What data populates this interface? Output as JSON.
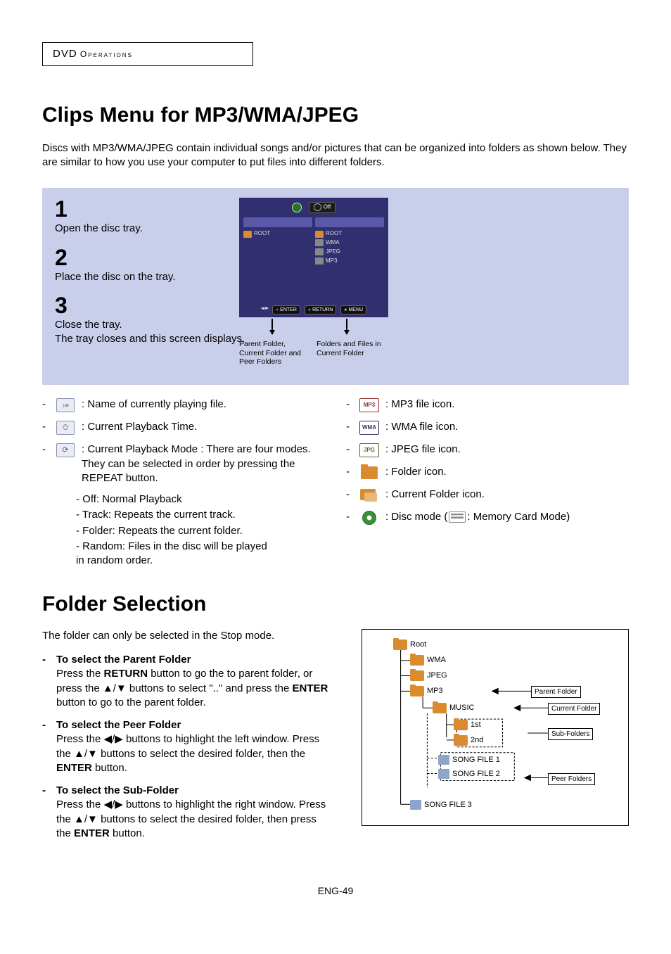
{
  "header": {
    "dvd": "DVD",
    "ops": "Operations"
  },
  "title": "Clips Menu for MP3/WMA/JPEG",
  "intro": "Discs with MP3/WMA/JPEG contain individual songs and/or pictures that can be organized into folders as shown below.  They are similar to how you use your computer to put files into different folders.",
  "steps": {
    "s1": {
      "num": "1",
      "text": "Open the disc tray."
    },
    "s2": {
      "num": "2",
      "text": "Place the disc on the tray."
    },
    "s3": {
      "num": "3",
      "text": "Close the tray.\nThe tray closes and this screen displays."
    }
  },
  "mock": {
    "off": "Off",
    "root_left": "ROOT",
    "root_right": "ROOT",
    "wma": "WMA",
    "jpeg": "JPEG",
    "mp3": "MP3",
    "enter": "ENTER",
    "return": "RETURN",
    "menu": "MENU",
    "caption_left": "Parent Folder, Current Folder and Peer Folders",
    "caption_right": "Folders and Files in Current Folder"
  },
  "left_items": {
    "playing": ":  Name of currently playing file.",
    "time": ":  Current Playback Time.",
    "mode": ": Current Playback Mode : There are four modes. They can be selected in order by pressing the REPEAT button.",
    "sub": {
      "off": "- Off: Normal Playback",
      "track": "- Track: Repeats the current track.",
      "folder": "- Folder: Repeats the current folder.",
      "random": "- Random: Files in the disc will be played\n               in random order."
    }
  },
  "right_items": {
    "mp3": ": MP3 file icon.",
    "wma": ": WMA file icon.",
    "jpg": ": JPEG file icon.",
    "folder": ": Folder icon.",
    "curfolder": ": Current Folder icon.",
    "disc_pre": ": Disc mode (",
    "disc_post": ": Memory Card Mode)"
  },
  "folder_title": "Folder Selection",
  "folder_para": "The folder can only be selected in the Stop mode.",
  "folder_items": {
    "parent": {
      "head": "To select the Parent Folder",
      "body_pre": "Press the ",
      "btn_return": "RETURN",
      "body_mid1": " button to go the to parent folder, or press the ",
      "arrows_ud": "▲/▼",
      "body_mid2": " buttons to select \"..\" and press the ",
      "btn_enter": "ENTER",
      "body_end": " button to go to the parent folder."
    },
    "peer": {
      "head": "To select the Peer Folder",
      "line1_pre": "Press the ",
      "arrows_lr": "◀/▶",
      "line1_post": " buttons to highlight the left window.",
      "line2_pre": "Press the ",
      "arrows_ud": "▲/▼",
      "line2_post": " buttons to select the desired folder, then the ",
      "btn_enter": "ENTER",
      "line2_end": " button."
    },
    "sub": {
      "head": "To select the Sub-Folder",
      "line1_pre": "Press the ",
      "arrows_lr": "◀/▶",
      "line1_post": " buttons to highlight the right window.",
      "line2_pre": "Press the ",
      "arrows_ud": "▲/▼",
      "line2_post": " buttons to select the desired folder, then press the ",
      "btn_enter": "ENTER",
      "line2_end": " button."
    }
  },
  "tree": {
    "root": "Root",
    "wma": "WMA",
    "jpeg": "JPEG",
    "mp3": "MP3",
    "music": "MUSIC",
    "first": "1st",
    "second": "2nd",
    "song1": "SONG FILE 1",
    "song2": "SONG FILE 2",
    "song3": "SONG FILE 3",
    "lbl_parent": "Parent Folder",
    "lbl_current": "Current Folder",
    "lbl_sub": "Sub-Folders",
    "lbl_peer": "Peer Folders"
  },
  "page": "ENG-49"
}
